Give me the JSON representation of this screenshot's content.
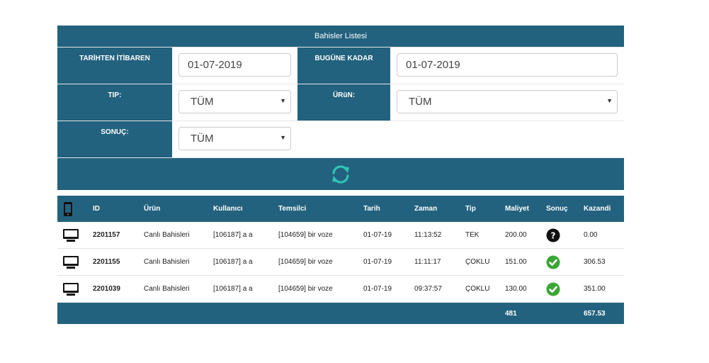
{
  "panel": {
    "title": "Bahisler Listesi",
    "from_label": "TARİHTEN İTİBAREN",
    "from_value": "01-07-2019",
    "to_label": "BUGÜNE KADAR",
    "to_value": "01-07-2019",
    "tip_label": "TIP:",
    "tip_value": "TÜM",
    "urun_label": "ÜRüN:",
    "urun_value": "TÜM",
    "sonuc_label": "SONUÇ:",
    "sonuc_value": "TÜM",
    "refresh_icon": "refresh-icon",
    "accent_color": "#22627e",
    "refresh_color": "#2ec4b6"
  },
  "table": {
    "headers": {
      "device_icon": "mobile-phone-icon",
      "id": "ID",
      "urun": "Ürün",
      "kullanici": "Kullanıcı",
      "temsilci": "Temsilci",
      "tarih": "Tarih",
      "zaman": "Zaman",
      "tip": "Tip",
      "maliyet": "Maliyet",
      "sonuc": "Sonuç",
      "kazandi": "Kazandi"
    },
    "rows": [
      {
        "device_icon": "desktop-icon",
        "id": "2201157",
        "urun": "Canlı Bahisleri",
        "kullanici": "[106187] a a",
        "temsilci": "[104659] bir voze",
        "tarih": "01-07-19",
        "zaman": "11:13:52",
        "tip": "TEK",
        "maliyet": "200.00",
        "sonuc_icon": "question-icon",
        "kazandi": "0.00"
      },
      {
        "device_icon": "desktop-icon",
        "id": "2201155",
        "urun": "Canlı Bahisleri",
        "kullanici": "[106187] a a",
        "temsilci": "[104659] bir voze",
        "tarih": "01-07-19",
        "zaman": "11:11:17",
        "tip": "ÇOKLU",
        "maliyet": "151.00",
        "sonuc_icon": "check-icon",
        "kazandi": "306.53"
      },
      {
        "device_icon": "desktop-icon",
        "id": "2201039",
        "urun": "Canlı Bahisleri",
        "kullanici": "[106187] a a",
        "temsilci": "[104659] bir voze",
        "tarih": "01-07-19",
        "zaman": "09:37:57",
        "tip": "ÇOKLU",
        "maliyet": "130.00",
        "sonuc_icon": "check-icon",
        "kazandi": "351.00"
      }
    ],
    "totals": {
      "maliyet": "481",
      "kazandi": "657.53"
    },
    "status_colors": {
      "won": "#3aa635",
      "pending": "#111111"
    }
  }
}
